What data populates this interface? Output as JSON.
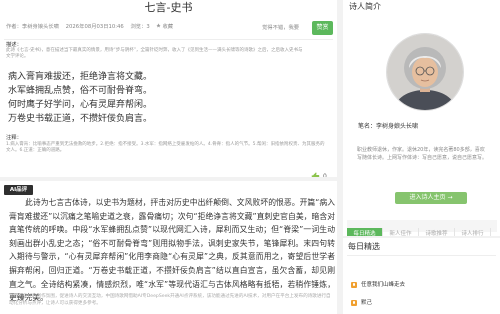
{
  "poem": {
    "title": "七言-史书",
    "author": "作者：李树身娘头长啸",
    "date": "2026年08月03日10:46",
    "views": "浏览：3",
    "favorite_label": "收藏",
    "like_prompt": "觉得不错，我要",
    "reward_label": "赞赏",
    "description_label": "描述：",
    "description": "此诗《七言-史书》，意在描述当下最真实的情景，用诗“步与阴杯”，全篇针砭时弊，收入了《见到生活——满头长啸等的诗歌》之后，之后收入史书与文学评论。",
    "lines": [
      "病入膏肓难拔还，拒绝诤言将文藏。",
      "水军蜂拥乱点赞，俗不可耐骨脊弯。",
      "何时鹰子好学问，心有灵犀弃帮闲。",
      "万卷史书载正道，不攒奸佞负肩言。"
    ],
    "notes_label": "注释：",
    "notes": "1.病入膏肓：比喻事态严重到无法挽救的地步。2.拒绝：指不接受。3.水军：指网络上受雇发帖的人。4.骨脊：指人的气节。5.帮闲：旧指依附权贵、为其服务的文人。6.正道：正确的道路。",
    "like_count": "0"
  },
  "ai_review": {
    "badge": "AI品评",
    "text": "此诗为七言古体诗，以史书为题材，抨击对历史中出纤颠倒、文风败坏的恨恶。开篇“病入膏肓难拔还”以沉痛之笔喻史道之衰，露骨痛切；次句“拒绝诤言将文藏”直刺史官自美，暗含对真笔传统的呼唤。中段“水军蜂拥乱点赞”以现代网汇入诗，犀利而又生动；但“脊梁”一词生动刻画出群小乱史之态；“俗不可耐骨脊弯”则用拟物手法，讽刺史家失节，笔锋犀利。末四句转入期待与警示，“心有灵犀弃帮闲”化用李商隐“心有灵犀”之典，反其意而用之，寄望后世学者摒弃帮闲，回归正道。“万卷史书载正道，不攒奸佞负肩言”结以直白宣言，虽欠含蓄，却见刚直之气。全诗结构紧凑，情感炽烈，唯“水军”等现代语汇与古体风格略有抵牾，若稍作锤炼，更臻完美。",
    "footnote": "为营造良好的创作氛围，促进诗人的交流互动，中国诗歌网借助AI专DeepSeek开通AI点评系统，该功能通过先进的AI技术，对用户在平台上发布的诗歌进行自动化分析与点评，让诗人可以获得更多参考。"
  },
  "poet": {
    "section_title": "诗人简介",
    "pen_name": "笔名：李树身娘头长啸",
    "bio": "职业教师退休，作家。退休20年，读完名著80多部，喜欢写随体长诗。上网写作体诗：写自己愿意，说自己愿意写。",
    "home_button": "进入诗人主页 →"
  },
  "tabs": [
    {
      "label": "每日精选",
      "active": true
    },
    {
      "label": "新人佳作",
      "active": false
    },
    {
      "label": "诗歌推荐",
      "active": false
    },
    {
      "label": "诗人排行",
      "active": false
    }
  ],
  "daily_picks": {
    "title": "每日精选",
    "items": [
      "任意我们山峰走去",
      "默己"
    ]
  },
  "colors": {
    "accent_green": "#5cb85c",
    "button_green": "#86c46e",
    "badge_dark": "#2f2f2f",
    "list_icon_orange": "#f0a030"
  },
  "icons": {
    "favorite": "star-icon",
    "like": "thumbs-up-icon",
    "pick": "hot-icon"
  }
}
